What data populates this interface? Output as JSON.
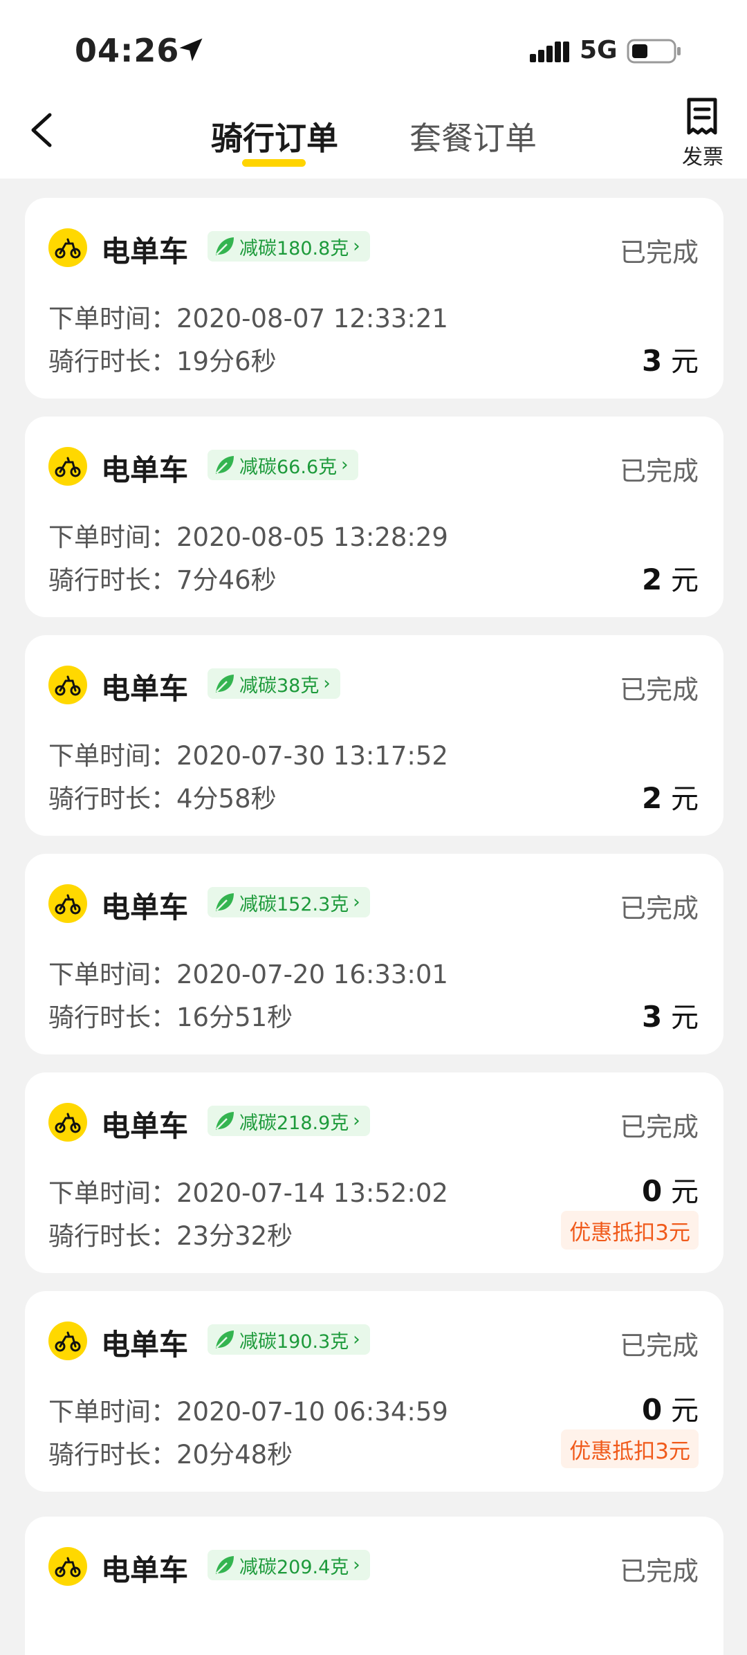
{
  "status_bar": {
    "time": "04:26",
    "network": "5G"
  },
  "header": {
    "tabs": [
      {
        "label": "骑行订单",
        "active": true
      },
      {
        "label": "套餐订单",
        "active": false
      }
    ],
    "invoice_label": "发票"
  },
  "labels": {
    "order_time": "下单时间：",
    "duration": "骑行时长：",
    "currency": "元"
  },
  "orders": [
    {
      "vehicle": "电单车",
      "carbon": "减碳180.8克",
      "status": "已完成",
      "order_time": "2020-08-07 12:33:21",
      "duration": "19分6秒",
      "amount": "3"
    },
    {
      "vehicle": "电单车",
      "carbon": "减碳66.6克",
      "status": "已完成",
      "order_time": "2020-08-05 13:28:29",
      "duration": "7分46秒",
      "amount": "2"
    },
    {
      "vehicle": "电单车",
      "carbon": "减碳38克",
      "status": "已完成",
      "order_time": "2020-07-30 13:17:52",
      "duration": "4分58秒",
      "amount": "2"
    },
    {
      "vehicle": "电单车",
      "carbon": "减碳152.3克",
      "status": "已完成",
      "order_time": "2020-07-20 16:33:01",
      "duration": "16分51秒",
      "amount": "3"
    },
    {
      "vehicle": "电单车",
      "carbon": "减碳218.9克",
      "status": "已完成",
      "order_time": "2020-07-14 13:52:02",
      "duration": "23分32秒",
      "amount": "0",
      "discount": "优惠抵扣3元"
    },
    {
      "vehicle": "电单车",
      "carbon": "减碳190.3克",
      "status": "已完成",
      "order_time": "2020-07-10 06:34:59",
      "duration": "20分48秒",
      "amount": "0",
      "discount": "优惠抵扣3元"
    },
    {
      "vehicle": "电单车",
      "carbon": "减碳209.4克",
      "status": "已完成"
    }
  ],
  "colors": {
    "brand_yellow": "#FFD400",
    "carbon_green": "#1d9a3b",
    "discount_orange": "#f05a1b"
  }
}
